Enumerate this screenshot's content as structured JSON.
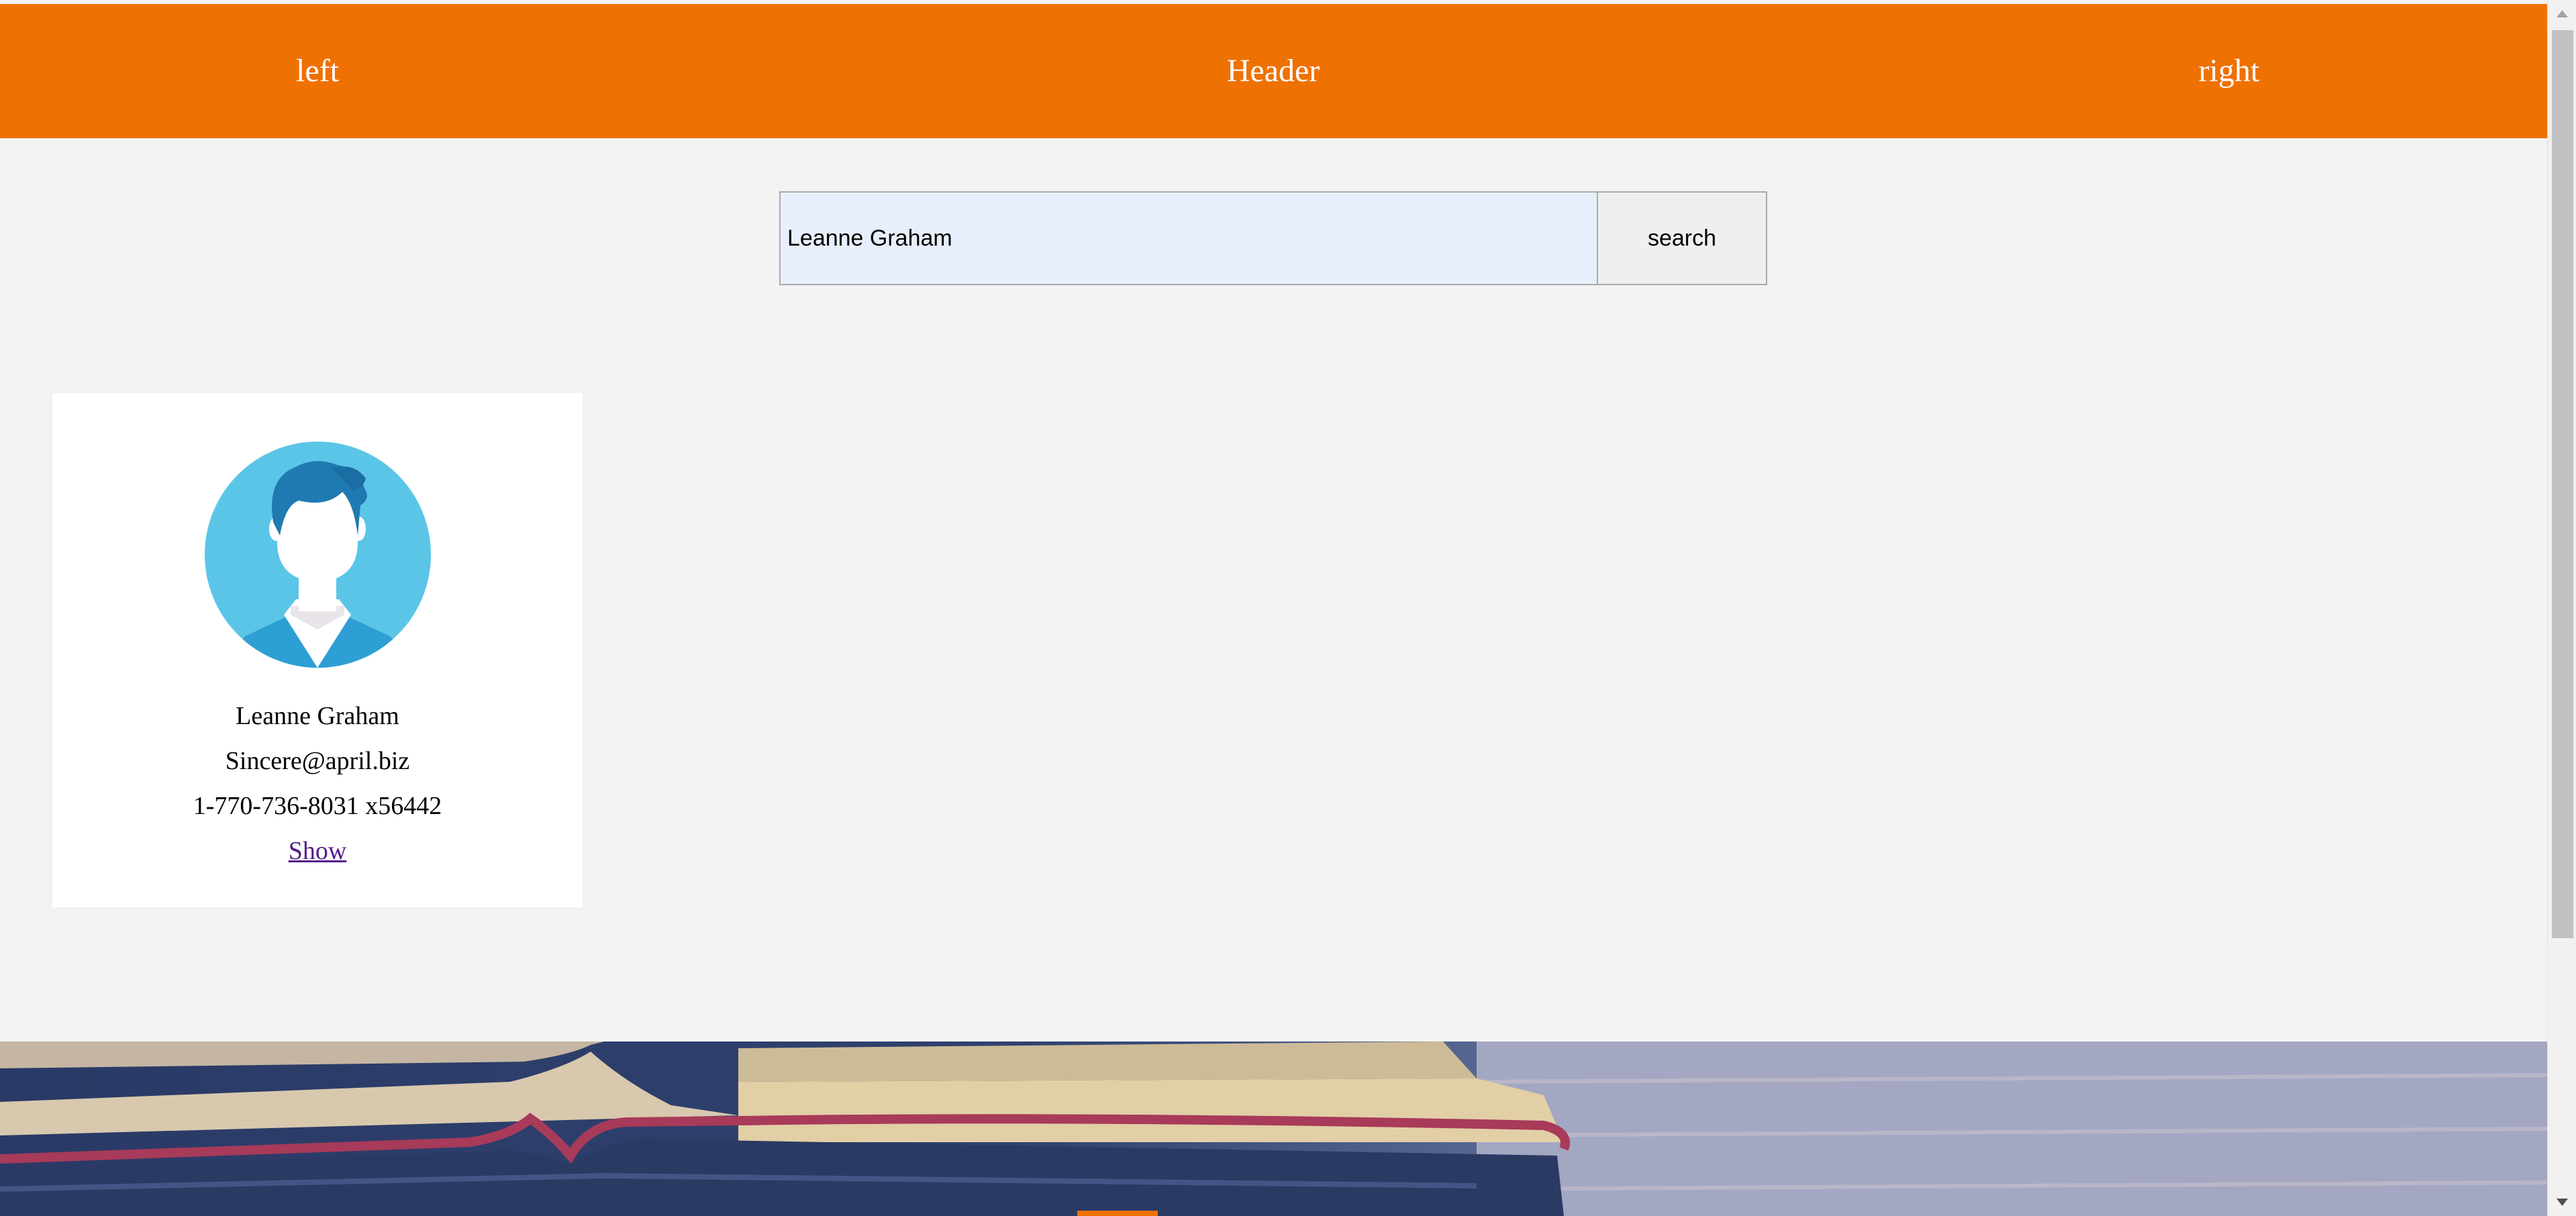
{
  "header": {
    "left": "left",
    "title": "Header",
    "right": "right",
    "background": "#ef7102"
  },
  "search": {
    "value": "Leanne Graham",
    "button_label": "search"
  },
  "user_card": {
    "avatar_icon": "user-avatar-icon",
    "name": "Leanne Graham",
    "email": "Sincere@april.biz",
    "phone": "1-770-736-8031 x56442",
    "show_label": "Show"
  },
  "footer": {
    "image": "open-book-banner"
  },
  "colors": {
    "accent": "#ef7102",
    "link_visited": "#551a8b",
    "page_bg": "#f2f2f2"
  }
}
